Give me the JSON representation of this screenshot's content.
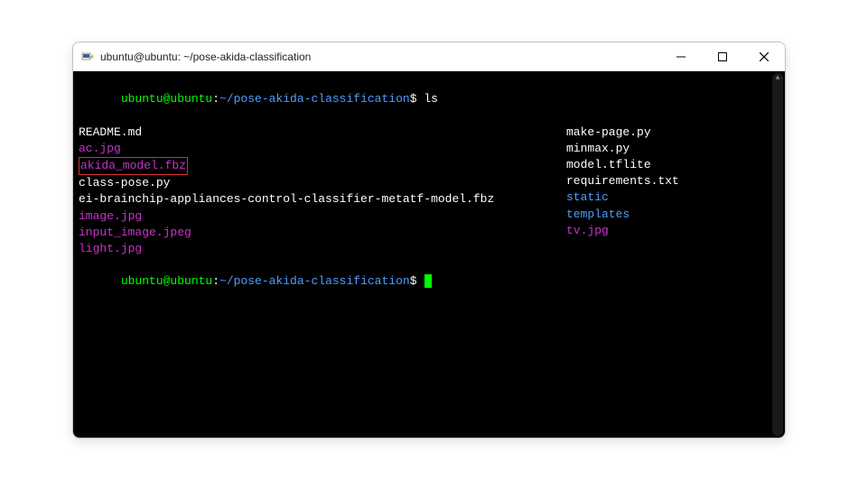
{
  "window": {
    "title": "ubuntu@ubuntu: ~/pose-akida-classification",
    "minimize_label": "Minimize",
    "maximize_label": "Maximize",
    "close_label": "Close"
  },
  "terminal": {
    "prompt_user_host": "ubuntu@ubuntu",
    "prompt_sep1": ":",
    "prompt_path": "~/pose-akida-classification",
    "prompt_dollar": "$",
    "command": "ls",
    "listing": {
      "left": [
        {
          "name": "README.md",
          "cls": "f-regular",
          "highlight": false
        },
        {
          "name": "ac.jpg",
          "cls": "f-image",
          "highlight": false
        },
        {
          "name": "akida_model.fbz",
          "cls": "f-image",
          "highlight": true
        },
        {
          "name": "class-pose.py",
          "cls": "f-regular",
          "highlight": false
        },
        {
          "name": "ei-brainchip-appliances-control-classifier-metatf-model.fbz",
          "cls": "f-regular",
          "highlight": false
        },
        {
          "name": "image.jpg",
          "cls": "f-image",
          "highlight": false
        },
        {
          "name": "input_image.jpeg",
          "cls": "f-image",
          "highlight": false
        },
        {
          "name": "light.jpg",
          "cls": "f-image",
          "highlight": false
        }
      ],
      "right": [
        {
          "name": "make-page.py",
          "cls": "f-regular"
        },
        {
          "name": "minmax.py",
          "cls": "f-regular"
        },
        {
          "name": "model.tflite",
          "cls": "f-regular"
        },
        {
          "name": "requirements.txt",
          "cls": "f-regular"
        },
        {
          "name": "static",
          "cls": "f-dir"
        },
        {
          "name": "templates",
          "cls": "f-dir"
        },
        {
          "name": "tv.jpg",
          "cls": "f-image"
        }
      ]
    }
  }
}
